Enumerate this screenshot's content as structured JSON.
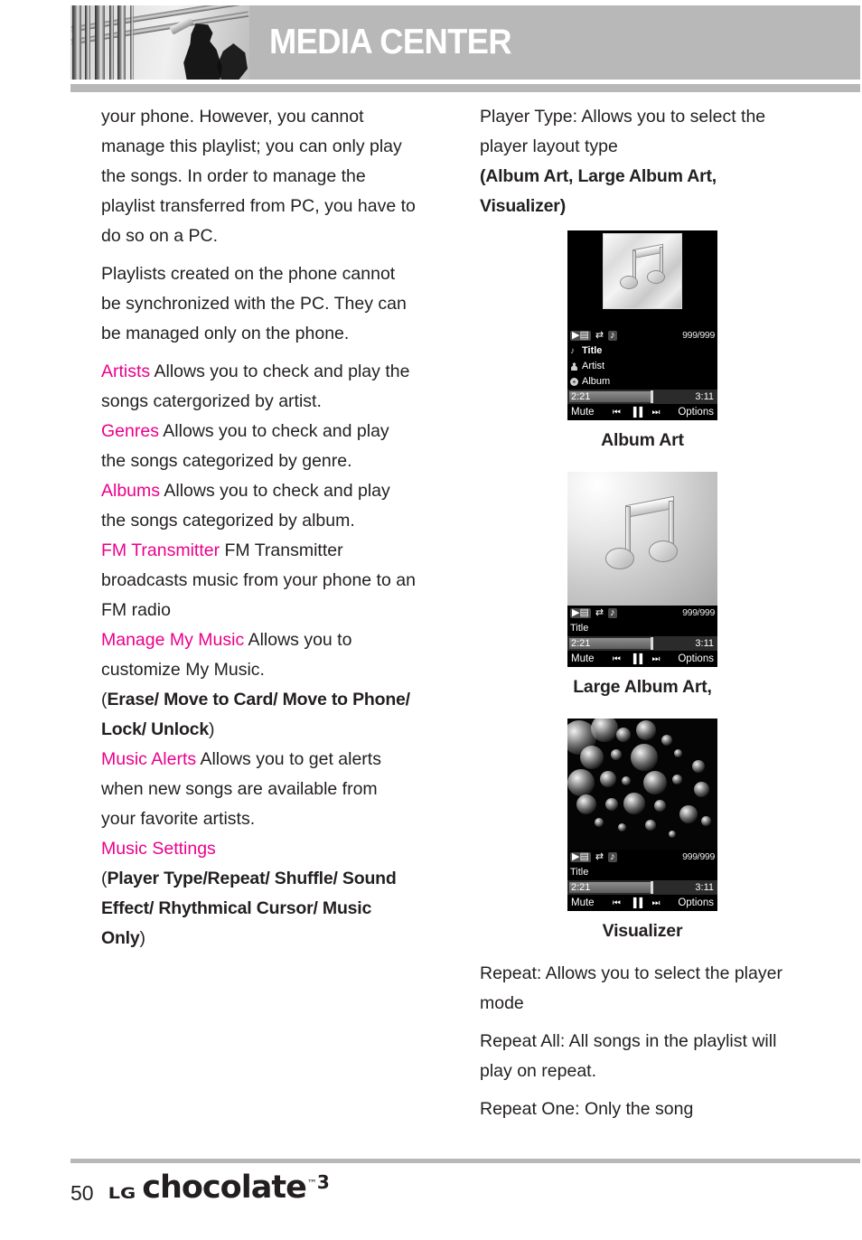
{
  "header": {
    "title": "MEDIA CENTER",
    "photo_alt": "jazz-musician-photo"
  },
  "left_column": {
    "paragraphs": [
      "your phone. However, you cannot manage this playlist; you can only play the songs. In order to manage the playlist transferred from PC, you have to do so on a PC.",
      "Playlists created on the phone cannot be synchronized with the PC. They can be managed only on the phone."
    ],
    "entries": [
      {
        "term": "Artists",
        "desc": " Allows you to check and play the songs catergorized by artist."
      },
      {
        "term": "Genres",
        "desc": " Allows you to check and play the songs categorized by genre."
      },
      {
        "term": "Albums",
        "desc": " Allows you to check and play the songs categorized by album."
      },
      {
        "term": "FM Transmitter",
        "desc": " FM Transmitter broadcasts music from your phone to an FM radio"
      },
      {
        "term": "Manage My Music",
        "desc": " Allows you to customize My Music."
      }
    ],
    "manage_options_open": "(",
    "manage_options_bold": "Erase/ Move to Card/ Move to Phone/ Lock/ Unlock",
    "manage_options_close": ")",
    "music_alerts_term": "Music Alerts",
    "music_alerts_desc": " Allows you to get alerts when new songs are available from your favorite artists.",
    "music_settings_term": "Music Settings",
    "music_settings_open": "(",
    "music_settings_bold": "Player Type/Repeat/ Shuffle/ Sound Effect/ Rhythmical Cursor/ Music Only",
    "music_settings_close": ")"
  },
  "right_column": {
    "player_type_intro": "Player Type: Allows you to select the player layout type",
    "player_type_options": "(Album Art, Large Album Art, Visualizer)",
    "captions": {
      "album_art": "Album Art",
      "large_album_art": "Large Album Art,",
      "visualizer": "Visualizer"
    },
    "repeat_intro": "Repeat: Allows you to select the player mode",
    "repeat_all": "Repeat All: All songs in the playlist will play on repeat.",
    "repeat_one": "Repeat One: Only the song"
  },
  "phone_ui": {
    "count": "999/999",
    "title": "Title",
    "artist": "Artist",
    "album": "Album",
    "elapsed": "2:21",
    "total": "3:11",
    "softkey_left": "Mute",
    "softkey_right": "Options",
    "prev_icon": "⏮",
    "pause_icon": "▐▐",
    "next_icon": "⏭",
    "repeat_icon": "repeat-icon",
    "shuffle_icon": "shuffle-icon",
    "soundeffect_icon": "sound-effect-icon"
  },
  "footer": {
    "page_number": "50",
    "brand_lg": "LG",
    "brand_name": "chocolate",
    "brand_tm": "™",
    "brand_version": "3"
  },
  "colors": {
    "accent_pink": "#ec008c",
    "header_gray": "#b8b8b8",
    "text": "#231f20"
  }
}
